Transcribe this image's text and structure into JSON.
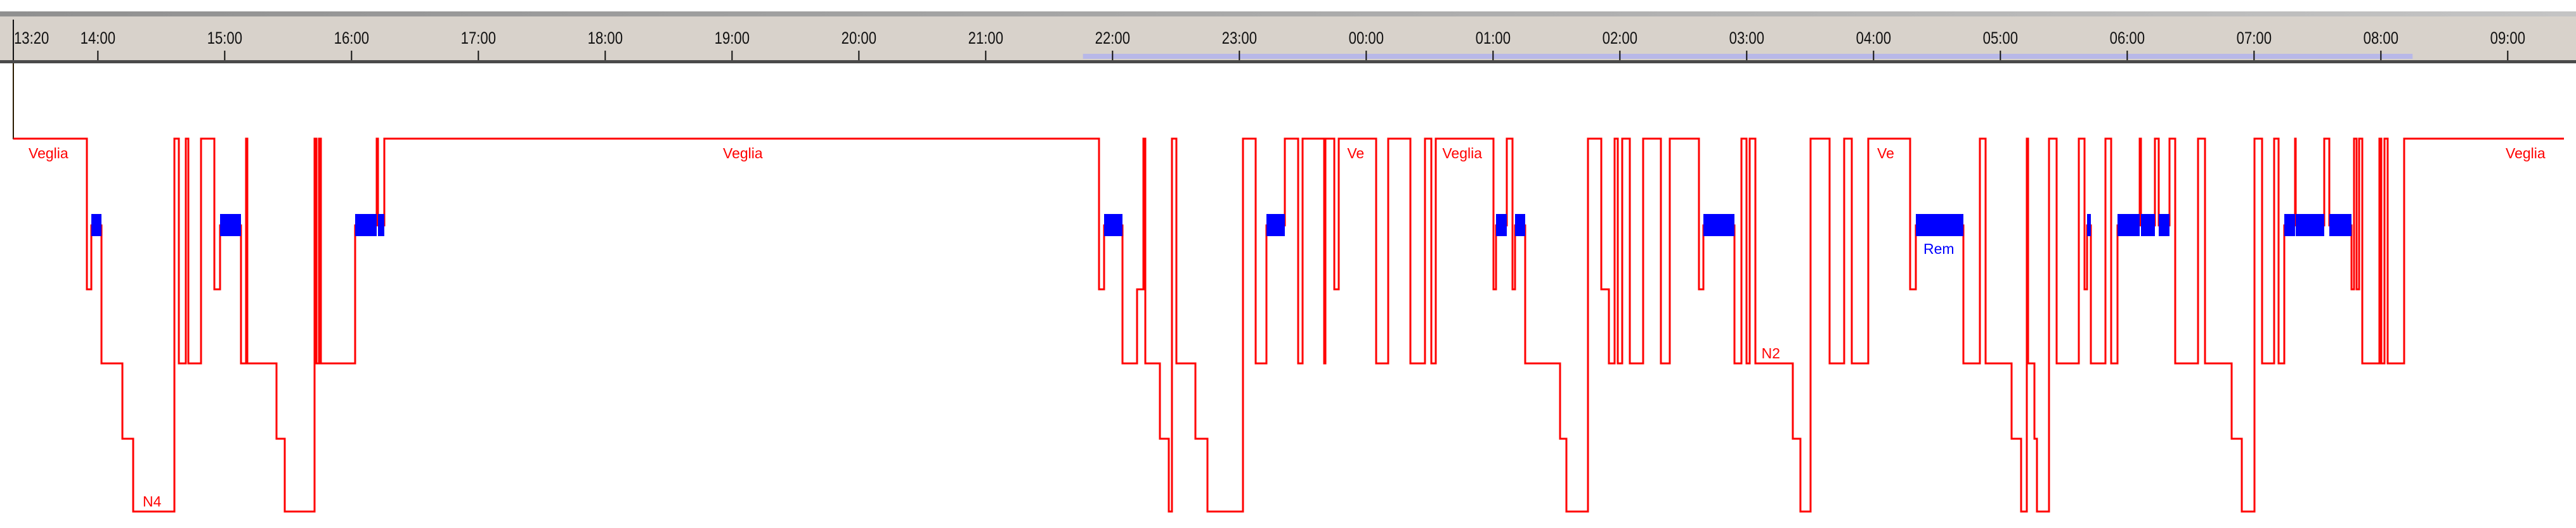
{
  "chart_data": {
    "type": "line",
    "subtype": "hypnogram",
    "x_unit": "minutes since 13:20",
    "x_start_label": "13:20",
    "x_range": [
      0,
      1212
    ],
    "tick_labels": [
      "14:00",
      "15:00",
      "16:00",
      "17:00",
      "18:00",
      "19:00",
      "20:00",
      "21:00",
      "22:00",
      "23:00",
      "00:00",
      "01:00",
      "02:00",
      "03:00",
      "04:00",
      "05:00",
      "06:00",
      "07:00",
      "08:00",
      "09:00"
    ],
    "stages_top_to_bottom": [
      "W",
      "R",
      "N1",
      "N2",
      "N3",
      "N4"
    ],
    "analysis_period": {
      "start_min": 506,
      "end_min": 1135
    },
    "end_min": 1206.6,
    "segments": [
      [
        0,
        "W"
      ],
      [
        34.8,
        "N1"
      ],
      [
        36.9,
        "R"
      ],
      [
        41.7,
        "N2"
      ],
      [
        51.6,
        "N3"
      ],
      [
        56.7,
        "N4"
      ],
      [
        76.2,
        "W"
      ],
      [
        78.3,
        "N2"
      ],
      [
        81.6,
        "W"
      ],
      [
        82.8,
        "N2"
      ],
      [
        88.8,
        "W"
      ],
      [
        95.1,
        "N1"
      ],
      [
        97.8,
        "R"
      ],
      [
        107.7,
        "N2"
      ],
      [
        110.1,
        "W"
      ],
      [
        110.7,
        "N2"
      ],
      [
        124.5,
        "N3"
      ],
      [
        128.4,
        "N4"
      ],
      [
        142.5,
        "W"
      ],
      [
        143.4,
        "N2"
      ],
      [
        144.6,
        "W"
      ],
      [
        145.5,
        "N2"
      ],
      [
        161.7,
        "R"
      ],
      [
        171.9,
        "W"
      ],
      [
        172.5,
        "R"
      ],
      [
        175.5,
        "W"
      ],
      [
        513.6,
        "N1"
      ],
      [
        516,
        "R"
      ],
      [
        524.7,
        "N2"
      ],
      [
        531.6,
        "N1"
      ],
      [
        534.6,
        "W"
      ],
      [
        535.5,
        "N2"
      ],
      [
        542.4,
        "N3"
      ],
      [
        546.6,
        "N4"
      ],
      [
        548.1,
        "W"
      ],
      [
        550.2,
        "N2"
      ],
      [
        559.2,
        "N3"
      ],
      [
        564.9,
        "N4"
      ],
      [
        581.7,
        "W"
      ],
      [
        587.7,
        "N2"
      ],
      [
        592.8,
        "R"
      ],
      [
        601.5,
        "W"
      ],
      [
        607.8,
        "N2"
      ],
      [
        609.9,
        "W"
      ],
      [
        620.1,
        "N2"
      ],
      [
        620.7,
        "W"
      ],
      [
        624.9,
        "N1"
      ],
      [
        627,
        "W"
      ],
      [
        644.7,
        "N2"
      ],
      [
        650.4,
        "W"
      ],
      [
        660.9,
        "N2"
      ],
      [
        667.8,
        "W"
      ],
      [
        670.8,
        "N2"
      ],
      [
        672.9,
        "W"
      ],
      [
        700.2,
        "N1"
      ],
      [
        701.4,
        "R"
      ],
      [
        706.5,
        "W"
      ],
      [
        709.2,
        "N1"
      ],
      [
        710.4,
        "R"
      ],
      [
        715.2,
        "N2"
      ],
      [
        731.7,
        "N3"
      ],
      [
        734.7,
        "N4"
      ],
      [
        744.9,
        "W"
      ],
      [
        751.2,
        "N1"
      ],
      [
        754.8,
        "N2"
      ],
      [
        757.5,
        "W"
      ],
      [
        759,
        "N2"
      ],
      [
        761.1,
        "W"
      ],
      [
        764.7,
        "N2"
      ],
      [
        771,
        "W"
      ],
      [
        779.4,
        "N2"
      ],
      [
        783.6,
        "W"
      ],
      [
        797.4,
        "N1"
      ],
      [
        799.5,
        "R"
      ],
      [
        814.2,
        "N2"
      ],
      [
        817.5,
        "W"
      ],
      [
        819.9,
        "N2"
      ],
      [
        821.4,
        "W"
      ],
      [
        824.1,
        "N2"
      ],
      [
        841.8,
        "N3"
      ],
      [
        845.4,
        "N4"
      ],
      [
        850.2,
        "W"
      ],
      [
        859.2,
        "N2"
      ],
      [
        866.1,
        "W"
      ],
      [
        869.7,
        "N2"
      ],
      [
        877.5,
        "W"
      ],
      [
        897.3,
        "N1"
      ],
      [
        900,
        "R"
      ],
      [
        922.5,
        "N2"
      ],
      [
        930.3,
        "W"
      ],
      [
        933,
        "N2"
      ],
      [
        945.3,
        "N3"
      ],
      [
        949.8,
        "N4"
      ],
      [
        952.5,
        "W"
      ],
      [
        953.1,
        "N2"
      ],
      [
        956.1,
        "N3"
      ],
      [
        957.3,
        "N4"
      ],
      [
        963,
        "W"
      ],
      [
        966.6,
        "N2"
      ],
      [
        977.1,
        "W"
      ],
      [
        979.8,
        "N1"
      ],
      [
        981,
        "R"
      ],
      [
        982.8,
        "N2"
      ],
      [
        989.7,
        "W"
      ],
      [
        992.4,
        "N2"
      ],
      [
        995.4,
        "R"
      ],
      [
        1005.9,
        "W"
      ],
      [
        1006.5,
        "R"
      ],
      [
        1013.1,
        "W"
      ],
      [
        1014.9,
        "R"
      ],
      [
        1020,
        "W"
      ],
      [
        1022.7,
        "N2"
      ],
      [
        1033.5,
        "W"
      ],
      [
        1036.8,
        "N2"
      ],
      [
        1049.4,
        "N3"
      ],
      [
        1054.2,
        "N4"
      ],
      [
        1060.2,
        "W"
      ],
      [
        1063.8,
        "N2"
      ],
      [
        1069.5,
        "W"
      ],
      [
        1071.6,
        "N2"
      ],
      [
        1074.3,
        "R"
      ],
      [
        1079.4,
        "W"
      ],
      [
        1079.7,
        "R"
      ],
      [
        1093.2,
        "W"
      ],
      [
        1095.6,
        "R"
      ],
      [
        1106.1,
        "N1"
      ],
      [
        1107.3,
        "W"
      ],
      [
        1108.5,
        "N1"
      ],
      [
        1109.7,
        "W"
      ],
      [
        1111.2,
        "N2"
      ],
      [
        1119.3,
        "W"
      ],
      [
        1120.2,
        "N2"
      ],
      [
        1121.7,
        "W"
      ],
      [
        1123.2,
        "N2"
      ],
      [
        1131,
        "W"
      ]
    ],
    "annotations": [
      {
        "text": "Veglia",
        "at_min": 7.2,
        "stage": "W"
      },
      {
        "text": "N4",
        "at_min": 61.2,
        "stage": "N4"
      },
      {
        "text": "Veglia",
        "at_min": 335.7,
        "stage": "W"
      },
      {
        "text": "Ve",
        "at_min": 631,
        "stage": "W"
      },
      {
        "text": "Veglia",
        "at_min": 676,
        "stage": "W"
      },
      {
        "text": "N2",
        "at_min": 827,
        "stage": "N2"
      },
      {
        "text": "Ve",
        "at_min": 881.7,
        "stage": "W"
      },
      {
        "text": "Rem",
        "at_min": 903.6,
        "stage": "R"
      },
      {
        "text": "Veglia",
        "at_min": 1179,
        "stage": "W"
      }
    ],
    "colors": {
      "line": "#ff0000",
      "rem": "#0000ff",
      "rem_label": "#0000ff",
      "label": "#ff0000",
      "axis_bg": "#d8d2cb",
      "period": "#b8b8e8"
    }
  }
}
